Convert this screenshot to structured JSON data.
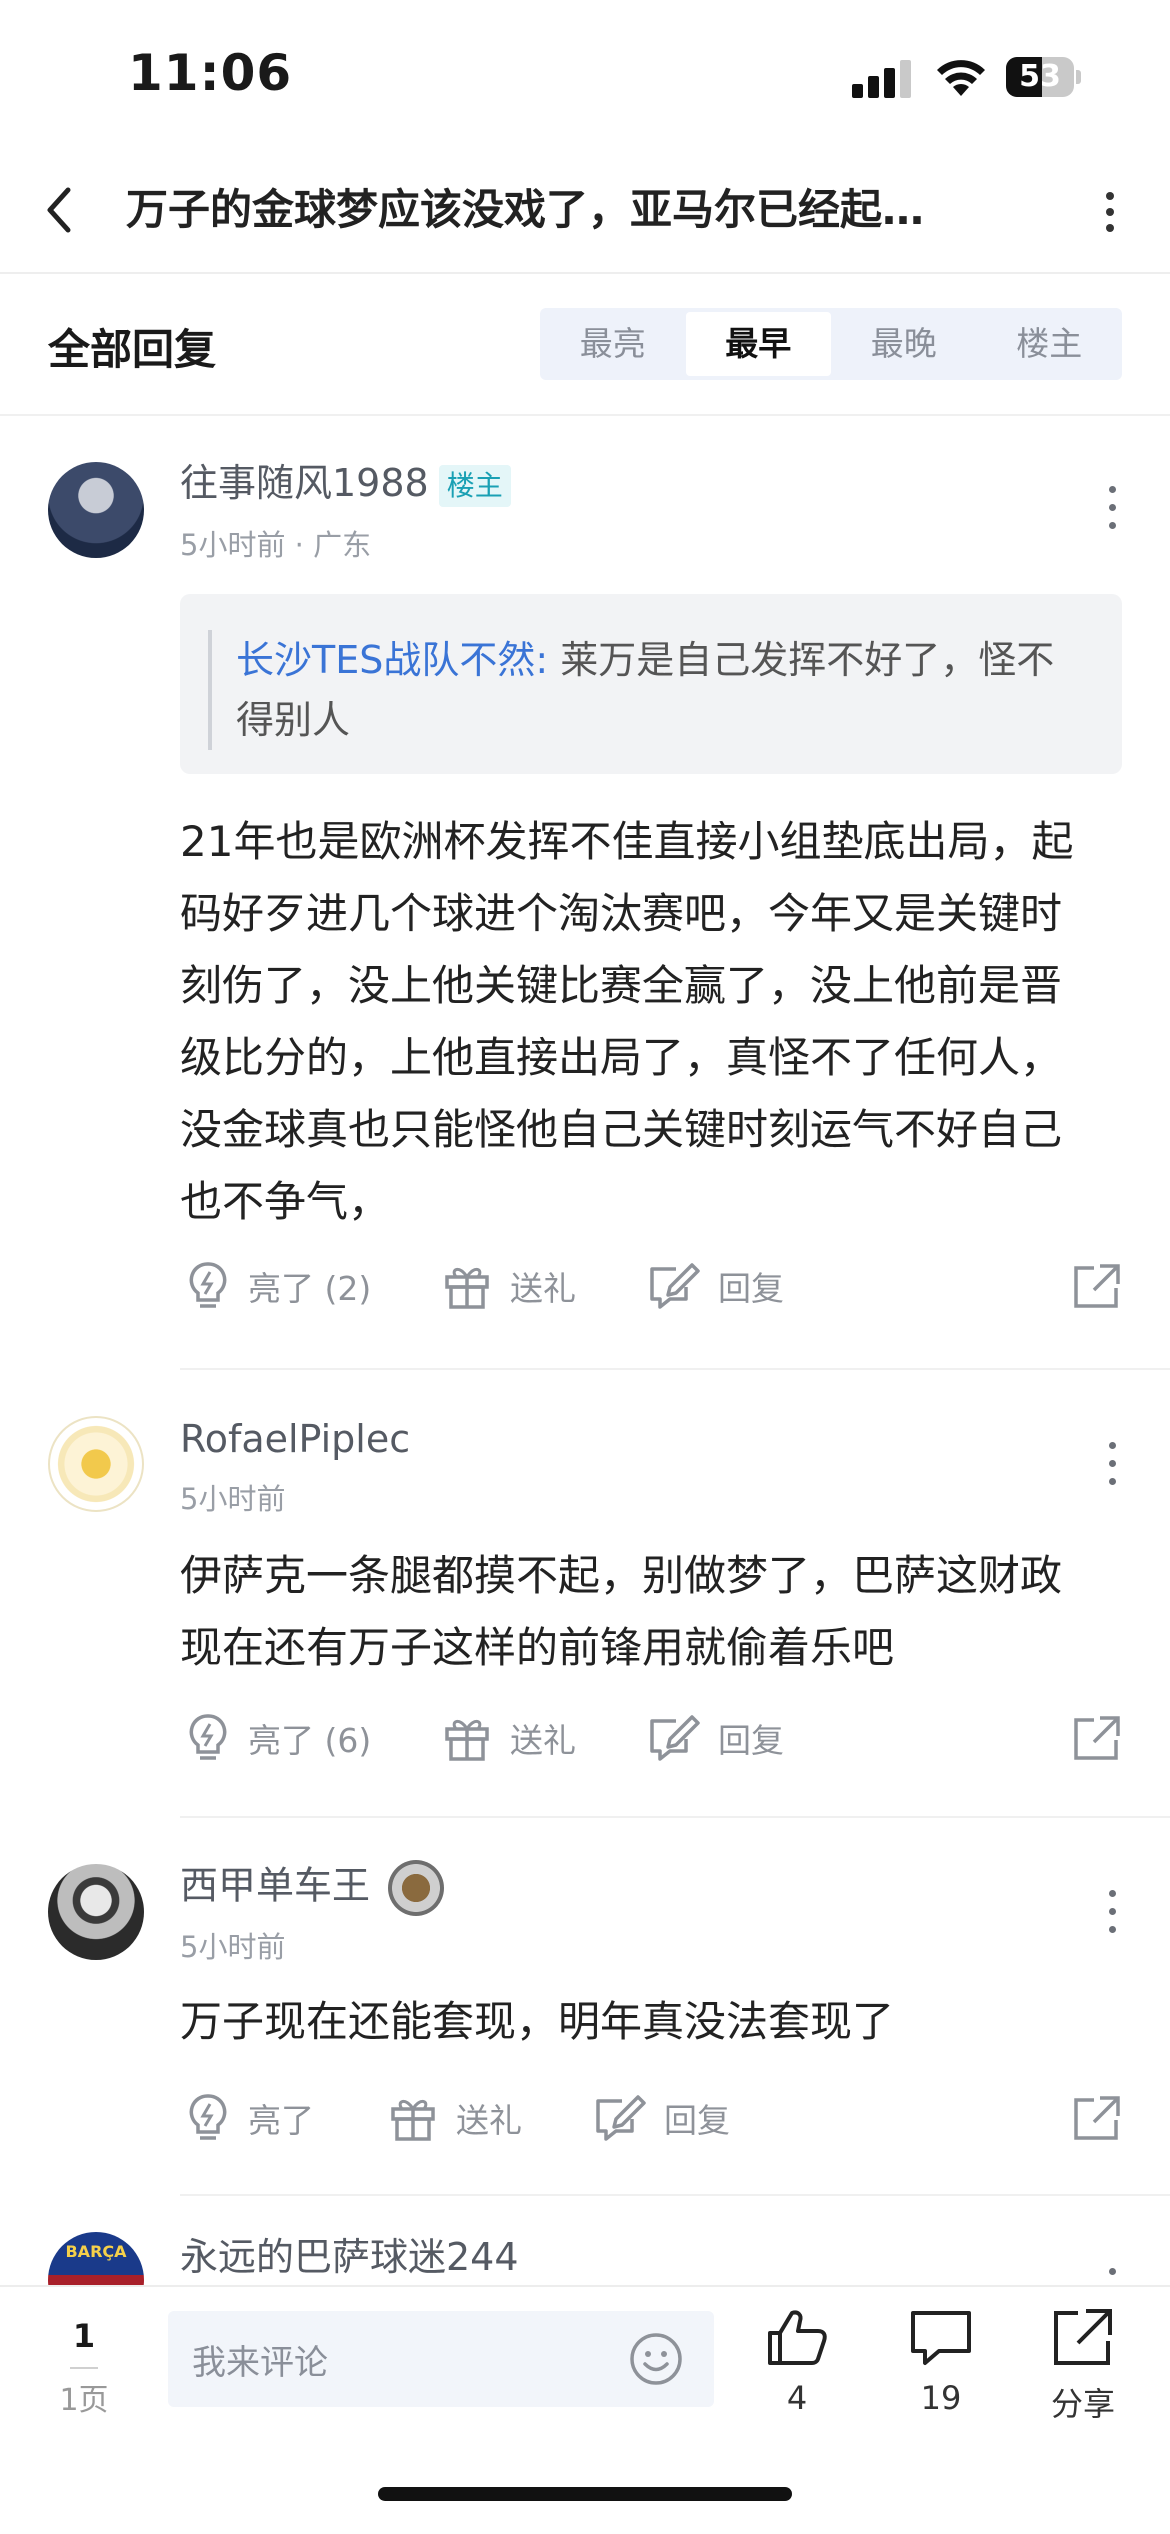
{
  "status_bar": {
    "time": "11:06",
    "battery": "53",
    "battery_level": 0.53
  },
  "header": {
    "title": "万子的金球梦应该没戏了，亚马尔已经起…"
  },
  "sort": {
    "title": "全部回复",
    "tabs": [
      {
        "label": "最亮",
        "active": false
      },
      {
        "label": "最早",
        "active": true
      },
      {
        "label": "最晚",
        "active": false
      },
      {
        "label": "楼主",
        "active": false
      }
    ]
  },
  "comments": [
    {
      "user": "往事随风1988",
      "owner_badge": "楼主",
      "meta": "5小时前 · 广东",
      "quote_user": "长沙TES战队不然:",
      "quote_text": " 莱万是自己发挥不好了，怪不得别人",
      "text": "21年也是欧洲杯发挥不佳直接小组垫底出局，起码好歹进几个球进个淘汰赛吧，今年又是关键时刻伤了，没上他关键比赛全赢了，没上他前是晋级比分的，上他直接出局了，真怪不了任何人，没金球真也只能怪他自己关键时刻运气不好自己也不争气，",
      "like_label": "亮了 (2)",
      "gift_label": "送礼",
      "reply_label": "回复"
    },
    {
      "user": "RofaelPiplec",
      "meta": "5小时前",
      "text": "伊萨克一条腿都摸不起，别做梦了，巴萨这财政现在还有万子这样的前锋用就偷着乐吧",
      "like_label": "亮了 (6)",
      "gift_label": "送礼",
      "reply_label": "回复"
    },
    {
      "user": "西甲单车王",
      "meta": "5小时前",
      "text": "万子现在还能套现，明年真没法套现了",
      "like_label": "亮了",
      "gift_label": "送礼",
      "reply_label": "回复"
    },
    {
      "user": "永远的巴萨球迷244",
      "avatar_text": "BARÇA"
    }
  ],
  "bottom_bar": {
    "page_number": "1",
    "page_label": "1页",
    "input_placeholder": "我来评论",
    "like_count": "4",
    "comment_count": "19",
    "share_label": "分享"
  },
  "colors": {
    "accent_link": "#3a74d6",
    "owner_badge": "#1aa0b4",
    "muted_text": "#8e9299",
    "tab_bg": "#eef2fa"
  },
  "icons": [
    "back-arrow-icon",
    "more-vertical-icon",
    "light-bulb-icon",
    "gift-icon",
    "reply-edit-icon",
    "share-out-icon",
    "smiley-icon",
    "thumbs-up-icon",
    "comment-bubble-icon",
    "signal-icon",
    "wifi-icon",
    "battery-icon"
  ]
}
